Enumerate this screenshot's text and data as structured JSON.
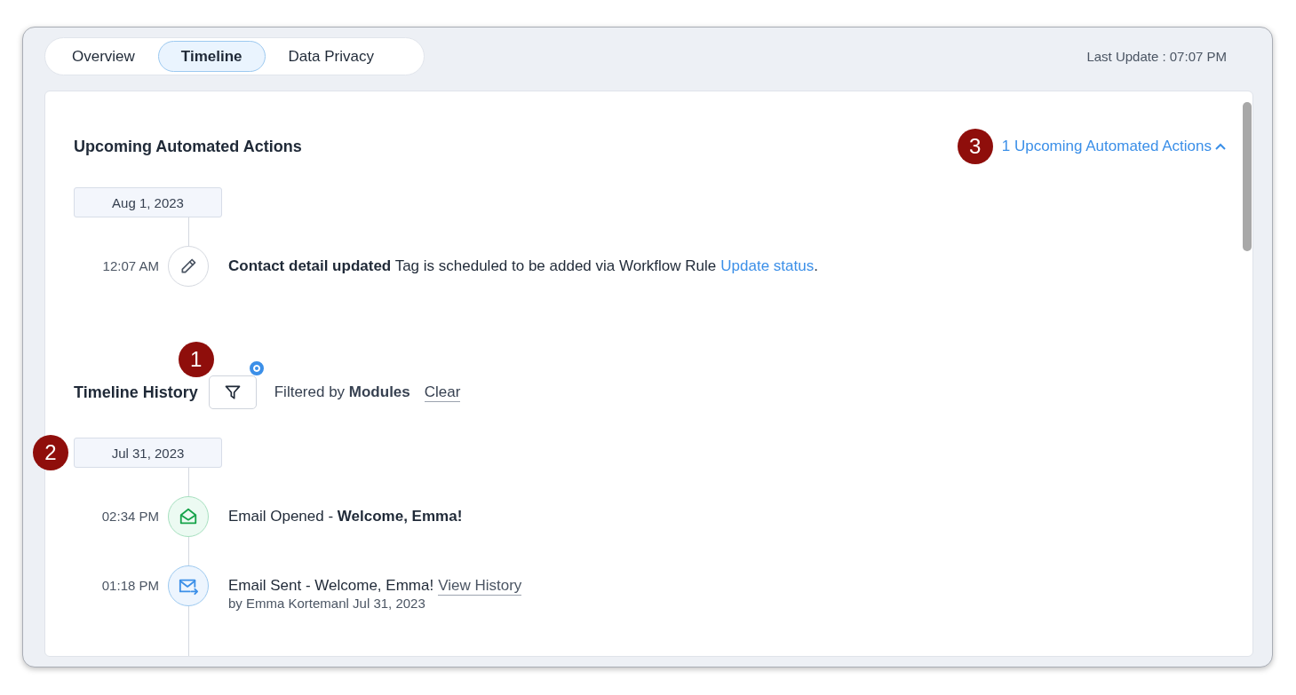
{
  "tabs": [
    {
      "label": "Overview",
      "selected": false
    },
    {
      "label": "Timeline",
      "selected": true
    },
    {
      "label": "Data Privacy",
      "selected": false
    }
  ],
  "last_update": "Last Update : 07:07 PM",
  "upcoming": {
    "title": "Upcoming Automated Actions",
    "callout": "3",
    "toggle": {
      "label": "1 Upcoming Automated Actions",
      "expanded": true
    },
    "date": "Aug 1, 2023",
    "entries": [
      {
        "kind": "edit",
        "time": "12:07 AM",
        "text": "**Contact detail updated** Tag is scheduled to be added via Workflow Rule",
        "link": {
          "kind": "action",
          "label": "Update status"
        },
        "suffix": "."
      }
    ]
  },
  "history": {
    "title": "Timeline History",
    "filter_callout": "1",
    "filter_active": true,
    "filter_text": "Filtered by **Modules**",
    "clear": "Clear",
    "date_callout": "2",
    "date": "Jul 31, 2023",
    "entries": [
      {
        "kind": "email-opened",
        "time": "02:34 PM",
        "text": "Email Opened - **Welcome, Emma!**"
      },
      {
        "kind": "email-sent",
        "time": "01:18 PM",
        "text": "Email Sent - Welcome, Emma!",
        "link": {
          "kind": "history",
          "label": "View History"
        },
        "sub": "by Emma Kortemanl Jul 31, 2023"
      }
    ]
  }
}
